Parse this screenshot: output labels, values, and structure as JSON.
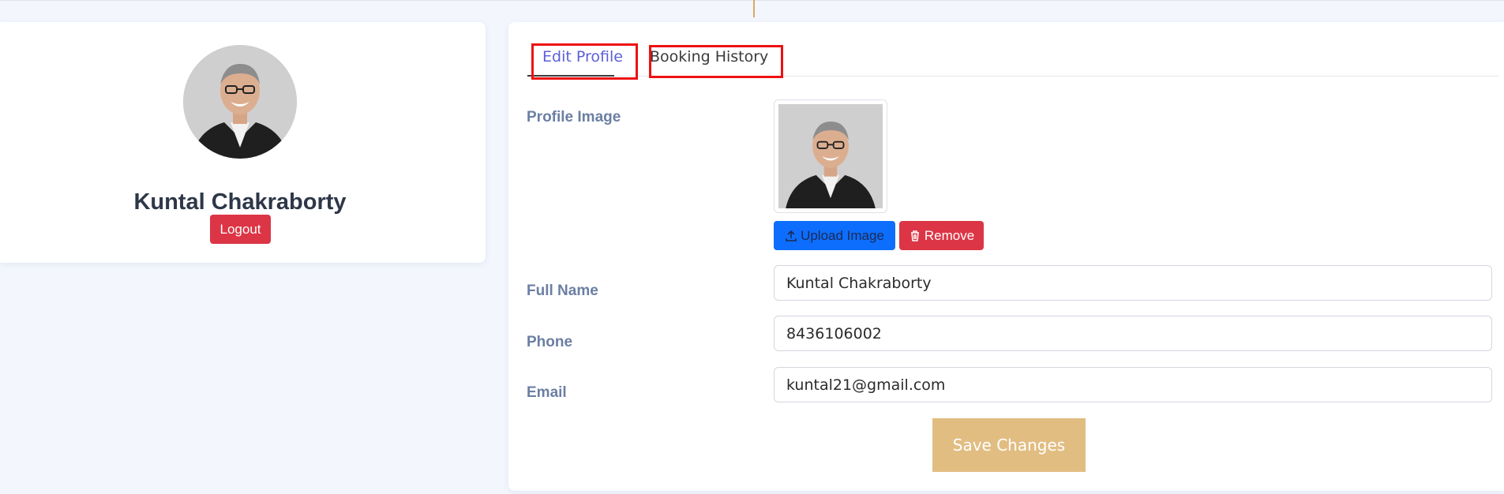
{
  "profile": {
    "name": "Kuntal Chakraborty",
    "logout_label": "Logout"
  },
  "tabs": [
    {
      "label": "Edit Profile",
      "active": true
    },
    {
      "label": "Booking History",
      "active": false
    }
  ],
  "form": {
    "profile_image_label": "Profile Image",
    "upload_label": "Upload Image",
    "remove_label": "Remove",
    "full_name_label": "Full Name",
    "full_name_value": "Kuntal Chakraborty",
    "phone_label": "Phone",
    "phone_value": "8436106002",
    "email_label": "Email",
    "email_value": "kuntal21@gmail.com",
    "save_label": "Save Changes"
  },
  "icons": {
    "upload": "upload-icon",
    "remove": "trash-icon"
  },
  "colors": {
    "accent_tab": "#5b5fd6",
    "danger": "#dc3545",
    "primary": "#0d6efd",
    "save": "#e2bd82",
    "highlight_box": "#ee1111"
  }
}
